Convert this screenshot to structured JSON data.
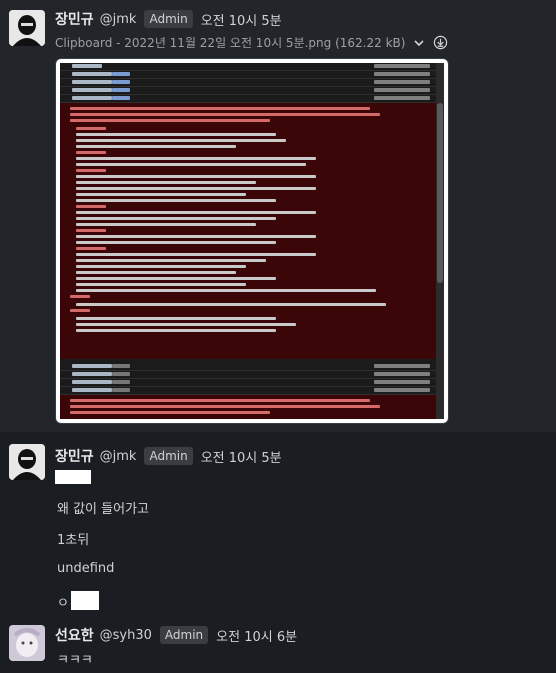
{
  "messages": [
    {
      "author": "장민규",
      "handle": "@jmk",
      "role_badge": "Admin",
      "time": "오전 10시 5분",
      "attachment": {
        "title": "Clipboard - 2022년 11월 22일 오전 10시 5분.png (162.22 kB)",
        "icons": [
          "chevron-down-icon",
          "download-icon"
        ]
      }
    },
    {
      "author": "장민규",
      "handle": "@jmk",
      "role_badge": "Admin",
      "time": "오전 10시 5분",
      "lines": [
        "왜 값이 들어가고",
        "1초뒤",
        "undefind",
        "ㅇ"
      ]
    },
    {
      "author": "선요한",
      "handle": "@syh30",
      "role_badge": "Admin",
      "time": "오전 10시 6분",
      "lines": [
        "ㅋㅋㅋ"
      ]
    }
  ],
  "colors": {
    "background": "#1a1d21",
    "hover_background": "#222529",
    "error_background": "#3b0608",
    "badge_background": "#3a3d42"
  }
}
